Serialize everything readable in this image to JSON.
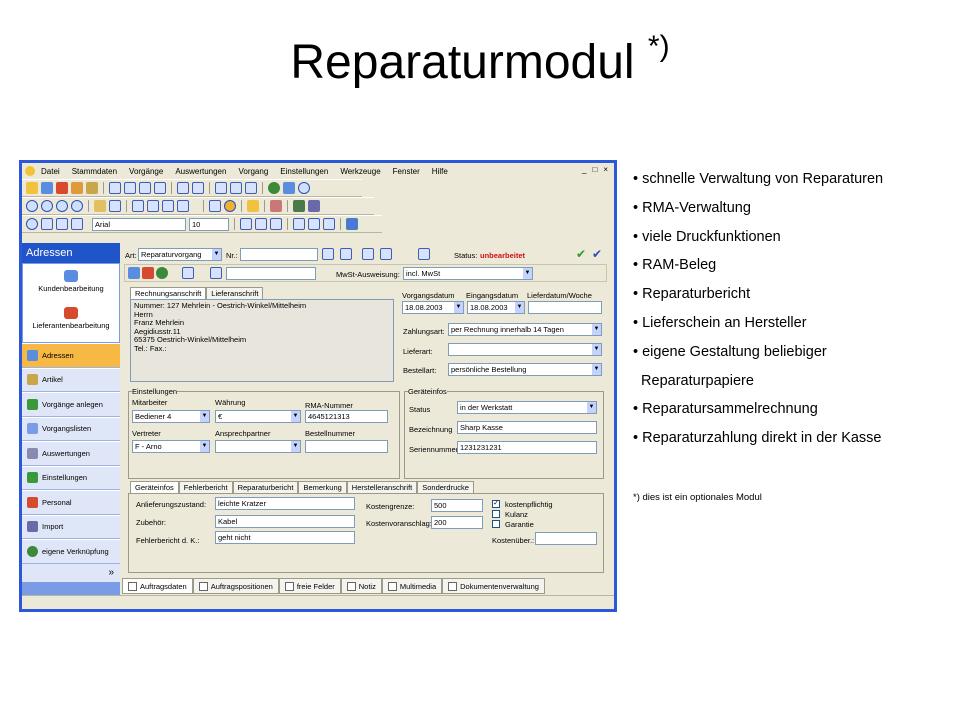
{
  "slide": {
    "title": "Reparaturmodul",
    "title_mark": "*)",
    "bullets": [
      "• schnelle Verwaltung von Reparaturen",
      "• RMA-Verwaltung",
      "• viele Druckfunktionen",
      "• RAM-Beleg",
      "• Reparaturbericht",
      "• Lieferschein an Hersteller",
      "• eigene Gestaltung beliebiger",
      "  Reparaturpapiere",
      "• Reparatursammelrechnung",
      "• Reparaturzahlung direkt in der Kasse"
    ],
    "footnote": "*) dies ist ein optionales Modul"
  },
  "app": {
    "menu": [
      "Datei",
      "Stammdaten",
      "Vorgänge",
      "Auswertungen",
      "Vorgang",
      "Einstellungen",
      "Werkzeuge",
      "Fenster",
      "Hilfe"
    ],
    "window_controls": [
      "_",
      "□",
      "×"
    ],
    "font_name": "Arial",
    "font_size": "10",
    "colors": {
      "accent": "#2054c9",
      "active_nav": "#f8b844",
      "status": "#d01010"
    },
    "nav": {
      "header": "Adressen",
      "top_items": [
        "Kundenbearbeitung",
        "Lieferantenbearbeitung"
      ],
      "items": [
        "Adressen",
        "Artikel",
        "Vorgänge anlegen",
        "Vorgangslisten",
        "Auswertungen",
        "Einstellungen",
        "Personal",
        "Import",
        "eigene Verknüpfung"
      ],
      "more": "»"
    },
    "form": {
      "art_label": "Art:",
      "art_value": "Reparaturvorgang",
      "nr_label": "Nr.:",
      "status_label": "Status:",
      "status_value": "unbearbeitet",
      "mwst_label": "MwSt-Ausweisung:",
      "mwst_value": "incl. MwSt",
      "addr_tabs": [
        "Rechnungsanschrift",
        "Lieferanschrift"
      ],
      "address_lines": [
        "Nummer: 127  Mehrlein - Oestrich-Winkel/Mittelheim",
        "Herrn",
        "Franz Mehrlein",
        "Aegidiusstr.11",
        "65375 Oestrich-Winkel/Mittelheim",
        "Tel.:  Fax.:"
      ],
      "date_headers": [
        "Vorgangsdatum",
        "Eingangsdatum",
        "Lieferdatum/Woche"
      ],
      "vorgangsdatum": "18.08.2003",
      "eingangsdatum": "18.08.2003",
      "zahlungsart_label": "Zahlungsart:",
      "zahlungsart_value": "per Rechnung innerhalb 14 Tagen",
      "lieferart_label": "Lieferart:",
      "bestellart_label": "Bestellart:",
      "bestellart_value": "persönliche Bestellung",
      "einstellungen_title": "Einstellungen",
      "mitarbeiter_label": "Mitarbeiter",
      "mitarbeiter_value": "Bediener 4",
      "waehrung_label": "Währung",
      "waehrung_value": "€",
      "rma_label": "RMA-Nummer",
      "rma_value": "4645121313",
      "vertreter_label": "Vertreter",
      "vertreter_value": "F - Arno",
      "ansprechpartner_label": "Ansprechpartner",
      "bestellnummer_label": "Bestellnummer",
      "geraeteinfos_title": "Geräteinfos",
      "status2_label": "Status",
      "status2_value": "in der Werkstatt",
      "bezeichnung_label": "Bezeichnung",
      "bezeichnung_value": "Sharp Kasse",
      "seriennummer_label": "Seriennummer",
      "seriennummer_value": "1231231231",
      "detail_tabs": [
        "Geräteinfos",
        "Fehlerbericht",
        "Reparaturbericht",
        "Bemerkung",
        "Herstelleranschrift",
        "Sonderdrucke"
      ],
      "anlieferung_label": "Anlieferungszustand:",
      "anlieferung_value": "leichte Kratzer",
      "zubehoer_label": "Zubehör:",
      "zubehoer_value": "Kabel",
      "fehlerbericht_label": "Fehlerbericht d. K.:",
      "fehlerbericht_value": "geht nicht",
      "kostengrenze_label": "Kostengrenze:",
      "kostengrenze_value": "500",
      "kostenvoranschlag_label": "Kostenvoranschlag:",
      "kostenvoranschlag_value": "200",
      "kostenpflichtig_label": "kostenpflichtig",
      "kulanz_label": "Kulanz",
      "garantie_label": "Garantie",
      "kostenueber_label": "Kostenüber.:"
    },
    "bottom_tabs": [
      "Auftragsdaten",
      "Auftragspositionen",
      "freie Felder",
      "Notiz",
      "Multimedia",
      "Dokumentenverwaltung"
    ]
  }
}
